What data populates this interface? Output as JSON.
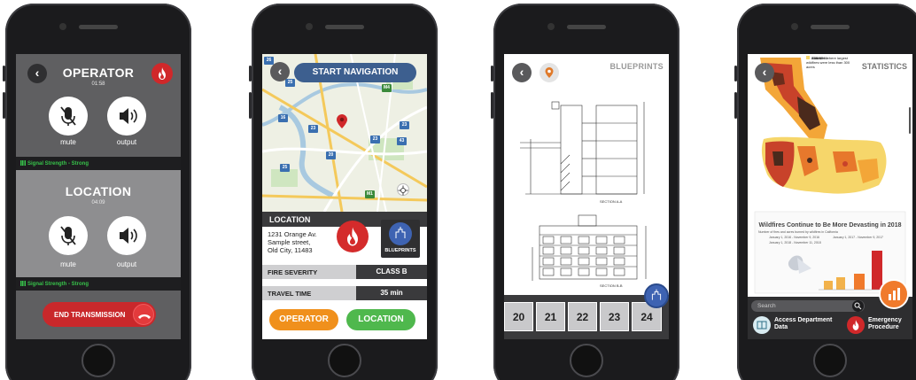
{
  "colors": {
    "phone_body": "#1b1b1d",
    "fire_red": "#d0282a",
    "nav_blue": "#3d5f8f",
    "signal_green": "#37c24a",
    "operator_orange": "#f0901c",
    "location_green": "#4fb84d",
    "blueprint_blue": "#3e63b2"
  },
  "phone1": {
    "operator": {
      "title": "OPERATOR",
      "time": "01:58",
      "mute_label": "mute",
      "output_label": "output"
    },
    "signal_top": "Signal Strength - Strong",
    "location": {
      "title": "LOCATION",
      "time": "04:09",
      "mute_label": "mute",
      "output_label": "output"
    },
    "signal_bottom": "Signal Strength - Strong",
    "end_button": "END TRANSMISSION",
    "icons": {
      "back": "back-icon",
      "fire": "fire-icon",
      "mute": "mute-mic-icon",
      "speaker": "speaker-icon",
      "hangup": "phone-hangup-icon"
    }
  },
  "phone2": {
    "start_nav": "START NAVIGATION",
    "map_badges": [
      "25",
      "26",
      "M4",
      "16",
      "23",
      "23",
      "23",
      "43",
      "20",
      "25",
      "M1"
    ],
    "location_header": "LOCATION",
    "address": {
      "line1": "1231 Orange Av.",
      "line2": "Sample street,",
      "line3": "Old City, 11483"
    },
    "blueprints_label": "BLUEPRINTS",
    "fire_severity_label": "FIRE SEVERITY",
    "fire_severity_value": "CLASS B",
    "travel_time_label": "TRAVEL TIME",
    "travel_time_value": "35 min",
    "operator_button": "OPERATOR",
    "location_button": "LOCATION"
  },
  "phone3": {
    "title": "BLUEPRINTS",
    "section_a": "SECTION A-A",
    "section_b": "SECTION B-B",
    "thumbs": [
      "20",
      "21",
      "22",
      "23",
      "24"
    ]
  },
  "phone4": {
    "title": "STATISTICS",
    "legend": [
      "101-1,000",
      "21-100",
      "1-20",
      "Counties where largest wildfires were less than 300 acres"
    ],
    "chart_title": "Wildfires Continue to Be More Devasting in 2018",
    "chart_subtitle": "Number of fires and acres burned by wildfires in California",
    "chart_legend": [
      "January 1, 2016 - November 9, 2016",
      "January 1, 2017 - November 9, 2017",
      "January 1, 2018 - November 11, 2018"
    ],
    "search_placeholder": "Search",
    "dept_label": "Access Department Data",
    "emergency_label": "Emergency Procedure"
  }
}
